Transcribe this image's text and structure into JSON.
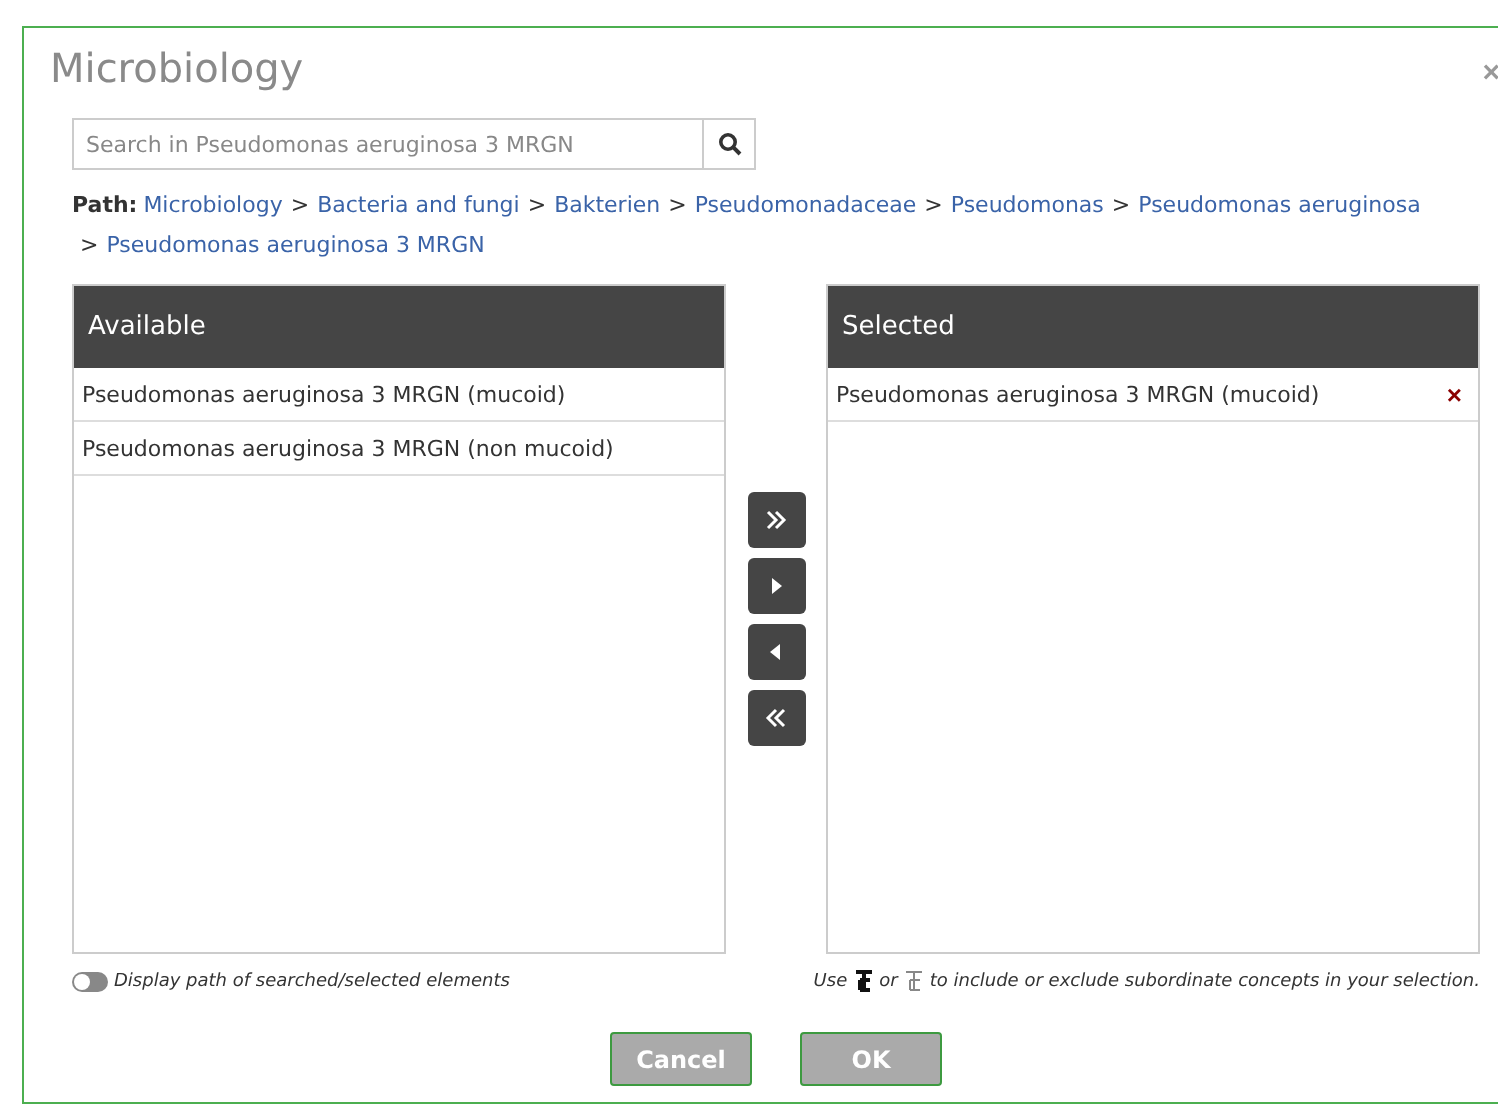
{
  "dialog": {
    "title": "Microbiology",
    "close": "×"
  },
  "search": {
    "placeholder": "Search in Pseudomonas aeruginosa 3 MRGN"
  },
  "path": {
    "label": "Path:",
    "separator": ">",
    "crumbs": [
      "Microbiology",
      "Bacteria and fungi",
      "Bakterien",
      "Pseudomonadaceae",
      "Pseudomonas",
      "Pseudomonas aeruginosa",
      "Pseudomonas aeruginosa 3 MRGN"
    ]
  },
  "available": {
    "heading": "Available",
    "items": [
      {
        "label": "Pseudomonas aeruginosa 3 MRGN (mucoid)"
      },
      {
        "label": "Pseudomonas aeruginosa 3 MRGN (non mucoid)"
      }
    ]
  },
  "transfer_buttons": [
    {
      "kind": "add-all"
    },
    {
      "kind": "add"
    },
    {
      "kind": "remove"
    },
    {
      "kind": "remove-all"
    }
  ],
  "selected": {
    "heading": "Selected",
    "items": [
      {
        "label": "Pseudomonas aeruginosa 3 MRGN (mucoid)",
        "remove": "×"
      }
    ]
  },
  "display_path_toggle": {
    "on": false,
    "label": "Display path of searched/selected elements"
  },
  "hint": {
    "parts": [
      "Use",
      "or",
      "to include or exclude subordinate concepts in your selection."
    ]
  },
  "buttons": [
    {
      "label": "Cancel"
    },
    {
      "label": "OK"
    }
  ]
}
